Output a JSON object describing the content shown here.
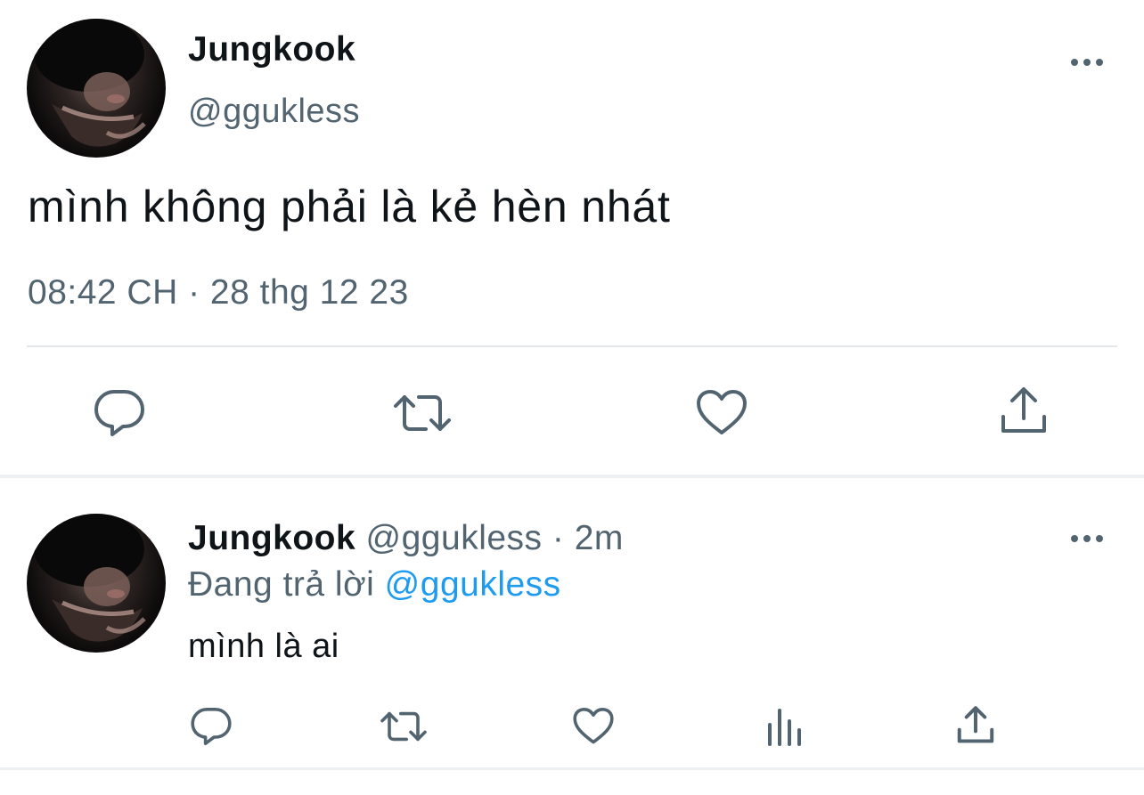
{
  "main_tweet": {
    "author_name": "Jungkook",
    "author_handle": "@ggukless",
    "text": "mình không phải là kẻ hèn nhát",
    "timestamp": "08:42 CH · 28 thg 12 23",
    "actions": [
      "reply-icon",
      "retweet-icon",
      "like-icon",
      "share-icon"
    ],
    "more_icon": "more-horizontal-icon"
  },
  "reply_tweet": {
    "author_name": "Jungkook",
    "author_handle": "@ggukless",
    "separator": "·",
    "time": "2m",
    "replying_prefix": "Đang trả lời",
    "replying_to": "@ggukless",
    "text": "mình là ai",
    "actions": [
      "reply-icon",
      "retweet-icon",
      "like-icon",
      "analytics-icon",
      "share-icon"
    ],
    "more_icon": "more-horizontal-icon"
  },
  "colors": {
    "text_primary": "#0f1419",
    "text_secondary": "#536471",
    "link": "#1d9bf0",
    "divider": "#e3e7ea"
  }
}
